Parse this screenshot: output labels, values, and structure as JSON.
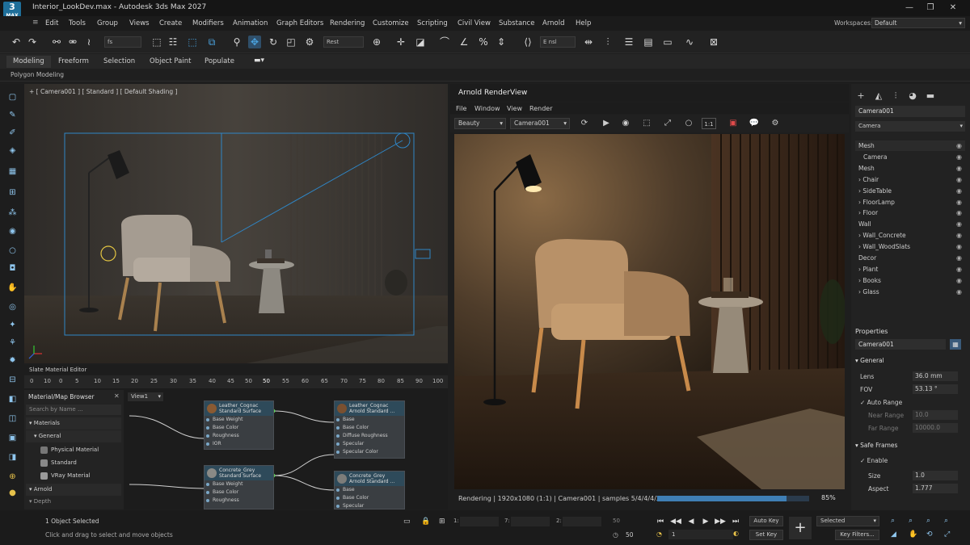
{
  "app": {
    "title": "Interior_LookDev.max - Autodesk 3ds Max 2027",
    "logo_number": "3",
    "logo_text": "MAX"
  },
  "menu": [
    "Edit",
    "Tools",
    "Group",
    "Views",
    "Create",
    "Modifiers",
    "Animation",
    "Graph Editors",
    "Rendering",
    "Customize",
    "Scripting",
    "Civil View",
    "Substance",
    "Arnold",
    "Help"
  ],
  "workspace": {
    "label": "Workspaces:",
    "value": "Default"
  },
  "toolbar": {
    "selection_filter": "fs",
    "snap_select": "Rest",
    "named_set": "E nsl"
  },
  "ribbon": {
    "tabs": [
      "Modeling",
      "Freeform",
      "Selection",
      "Object Paint",
      "Populate"
    ],
    "active": "Modeling",
    "sub": "Polygon Modeling"
  },
  "viewport": {
    "label": "+ [ Camera001 ] [ Standard ] [ Default Shading ]"
  },
  "slate": {
    "title": "Slate Material Editor",
    "timeline_ticks": [
      "0",
      "10",
      "5",
      "10",
      "15",
      "20",
      "25",
      "30",
      "35",
      "40",
      "45",
      "50",
      "55",
      "60",
      "65",
      "70",
      "75",
      "80",
      "85",
      "90",
      "95",
      "100"
    ],
    "browser_title": "Material/Map Browser",
    "browser_search": "Search by Name ...",
    "tree": {
      "materials": "Materials",
      "general": "General",
      "items": [
        "Physical Material",
        "Standard",
        "VRay Material"
      ],
      "arnold": "Arnold",
      "next": "Depth"
    },
    "view_tab": "View1",
    "nodes": [
      {
        "name": "Leather_Cognac",
        "type": "Standard Surface",
        "ports": [
          "Base Weight",
          "Base Color",
          "Roughness",
          "IOR"
        ],
        "color": "#8a5a32"
      },
      {
        "name": "Leather_Cognac",
        "type": "Arnold Standard ...",
        "ports": [
          "Base",
          "Base Color",
          "Diffuse Roughness",
          "Specular",
          "Specular Color"
        ],
        "color": "#7a5030"
      },
      {
        "name": "Concrete_Grey",
        "type": "Standard Surface",
        "ports": [
          "Base Weight",
          "Base Color",
          "Roughness"
        ],
        "color": "#8a8a86"
      },
      {
        "name": "Concrete_Grey",
        "type": "Arnold Standard ...",
        "ports": [
          "Base",
          "Base Color",
          "Specular"
        ],
        "color": "#7d7d7a"
      }
    ]
  },
  "renderview": {
    "title": "Arnold RenderView",
    "menu": [
      "File",
      "Window",
      "View",
      "Render"
    ],
    "aov": "Beauty",
    "camera": "Camera001",
    "ratio": "1:1",
    "status": "Rendering | 1920x1080 (1:1) | Camera001 | samples 5/4/4/4/2",
    "progress": 0.85,
    "percent": "85%"
  },
  "command_panel": {
    "object_name": "Camera001",
    "object_type": "Camera",
    "scene_items": [
      {
        "label": "Mesh",
        "indent": 0
      },
      {
        "label": "Camera",
        "indent": 1
      },
      {
        "label": "Mesh",
        "indent": 0
      },
      {
        "label": "› Chair",
        "indent": 0
      },
      {
        "label": "› SideTable",
        "indent": 0
      },
      {
        "label": "› FloorLamp",
        "indent": 0
      },
      {
        "label": "› Floor",
        "indent": 0
      },
      {
        "label": "Wall",
        "indent": 0
      },
      {
        "label": "› Wall_Concrete",
        "indent": 0
      },
      {
        "label": "› Wall_WoodSlats",
        "indent": 0
      },
      {
        "label": "Decor",
        "indent": 0
      },
      {
        "label": "› Plant",
        "indent": 0
      },
      {
        "label": "› Books",
        "indent": 0
      },
      {
        "label": "› Glass",
        "indent": 0
      }
    ],
    "properties_title": "Properties",
    "properties_name": "Camera001",
    "general": "General",
    "lens_label": "Lens",
    "lens_value": "36.0 mm",
    "fov_label": "FOV",
    "fov_value": "53.13 °",
    "auto_range": "Auto Range",
    "near_label": "Near Range",
    "near_value": "10.0",
    "far_label": "Far Range",
    "far_value": "10000.0",
    "safe_frames": "Safe Frames",
    "enable": "Enable",
    "size_label": "Size",
    "size_value": "1.0",
    "aspect_label": "Aspect",
    "aspect_value": "1.777"
  },
  "status": {
    "selected": "1 Object Selected",
    "hint": "Click and drag to select and move objects",
    "x_label": "1:",
    "y_label": "7:",
    "z_label": "2:",
    "z_value": "50",
    "frame": "50",
    "frame_field": "1",
    "auto_key": "Auto Key",
    "set_key": "Set Key",
    "key_mode": "Selected",
    "key_filters": "Key Filters..."
  }
}
